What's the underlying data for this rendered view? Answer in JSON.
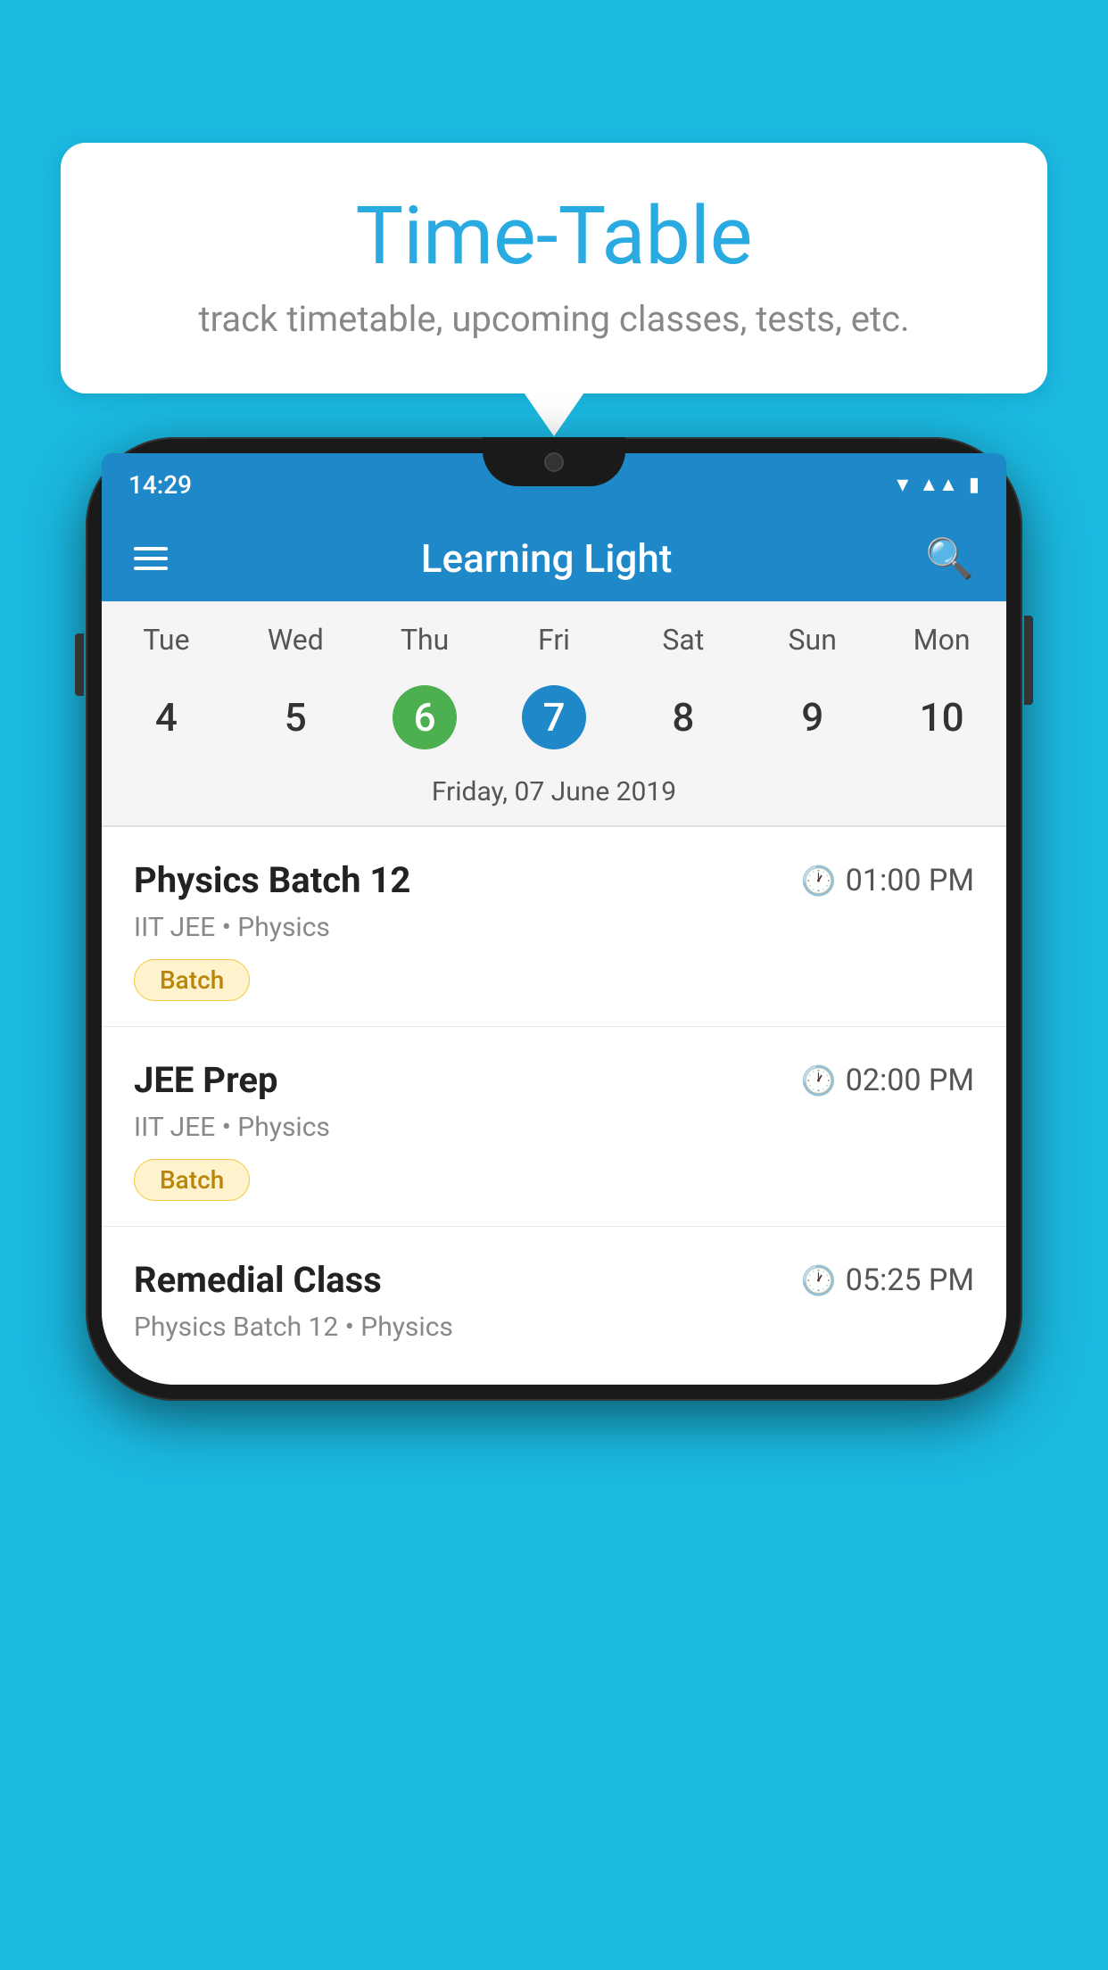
{
  "background_color": "#1bb8e0",
  "bubble": {
    "title": "Time-Table",
    "subtitle": "track timetable, upcoming classes, tests, etc."
  },
  "phone": {
    "status_bar": {
      "time": "14:29"
    },
    "app_header": {
      "title": "Learning Light"
    },
    "calendar": {
      "day_headers": [
        "Tue",
        "Wed",
        "Thu",
        "Fri",
        "Sat",
        "Sun",
        "Mon"
      ],
      "day_numbers": [
        "4",
        "5",
        "6",
        "7",
        "8",
        "9",
        "10"
      ],
      "today_index": 2,
      "selected_index": 3,
      "selected_date_label": "Friday, 07 June 2019"
    },
    "schedule_items": [
      {
        "title": "Physics Batch 12",
        "time": "01:00 PM",
        "subtitle": "IIT JEE • Physics",
        "badge": "Batch"
      },
      {
        "title": "JEE Prep",
        "time": "02:00 PM",
        "subtitle": "IIT JEE • Physics",
        "badge": "Batch"
      },
      {
        "title": "Remedial Class",
        "time": "05:25 PM",
        "subtitle": "Physics Batch 12 • Physics",
        "badge": null
      }
    ]
  }
}
